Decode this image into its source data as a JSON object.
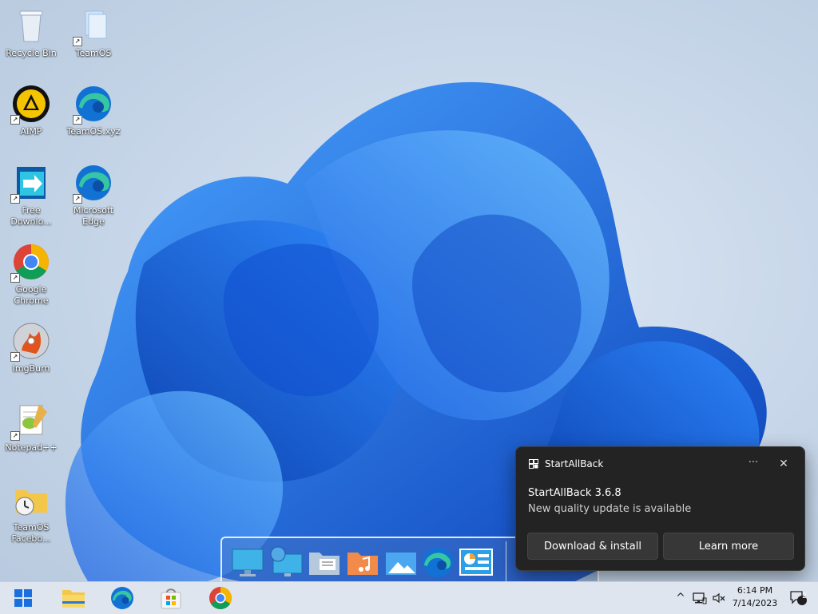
{
  "desktop": {
    "icons": [
      {
        "label": "Recycle Bin",
        "icon": "recycle-bin-icon"
      },
      {
        "label": "TeamOS",
        "icon": "folder-shortcut-icon"
      },
      {
        "label": "AIMP",
        "icon": "aimp-icon"
      },
      {
        "label": "TeamOS.xyz",
        "icon": "edge-icon"
      },
      {
        "label": "Free Downlo...",
        "icon": "free-download-manager-icon"
      },
      {
        "label": "Microsoft Edge",
        "icon": "edge-icon"
      },
      {
        "label": "Google Chrome",
        "icon": "chrome-icon"
      },
      {
        "label": "ImgBurn",
        "icon": "imgburn-icon"
      },
      {
        "label": "Notepad++",
        "icon": "notepadpp-icon"
      },
      {
        "label": "TeamOS Facebo...",
        "icon": "folder-clock-icon"
      }
    ]
  },
  "toast": {
    "app_name": "StartAllBack",
    "more_label": "···",
    "close_label": "✕",
    "title": "StartAllBack 3.6.8",
    "message": "New quality update is available",
    "primary_button": "Download & install",
    "secondary_button": "Learn more"
  },
  "dock": {
    "items": [
      "monitor-icon",
      "network-monitor-icon",
      "document-folder-icon",
      "music-folder-icon",
      "photos-icon",
      "edge-icon",
      "control-panel-icon"
    ]
  },
  "taskbar": {
    "items": [
      "start-icon",
      "file-explorer-icon",
      "edge-icon",
      "microsoft-store-icon",
      "chrome-icon"
    ],
    "tray": {
      "chevron": "^",
      "time": "6:14 PM",
      "date": "7/14/2023",
      "notification_count": "2"
    }
  },
  "colors": {
    "accent": "#1a6fe0",
    "toast_bg": "#232323",
    "taskbar_bg": "#dfe5ee"
  }
}
